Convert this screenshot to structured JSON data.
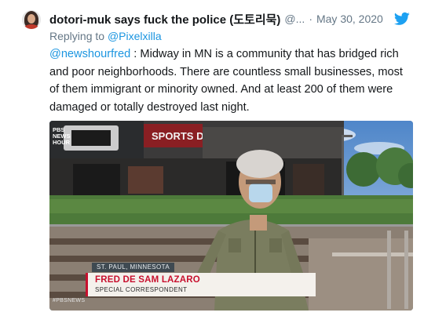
{
  "tweet": {
    "display_name": "dotori-muk says fuck the police (도토리묵)",
    "handle": "@...",
    "separator": "·",
    "date": "May 30, 2020",
    "reply_prefix": "Replying to ",
    "reply_to": "@Pixelxilla",
    "mention": "@newshourfred",
    "text_body": " : Midway in MN is a community that has bridged rich and poor neighborhoods. There are countless small businesses, most of them immigrant or minority owned. And at least 200 of them were damaged or totally destroyed last night.",
    "icons": {
      "avatar": "user-avatar",
      "platform": "twitter-bird-icon"
    },
    "accent_color": "#1da1f2"
  },
  "video_still": {
    "storefront_sign": "SPORTS DOME",
    "dateline": "ST. PAUL, MINNESOTA",
    "reporter_name": "FRED DE SAM LAZARO",
    "reporter_title": "SPECIAL CORRESPONDENT",
    "network_logo_lines": [
      "PBS",
      "NEWS",
      "HOUR"
    ],
    "hashtag": "#PBSNEWS",
    "brand_color": "#c8102e"
  }
}
